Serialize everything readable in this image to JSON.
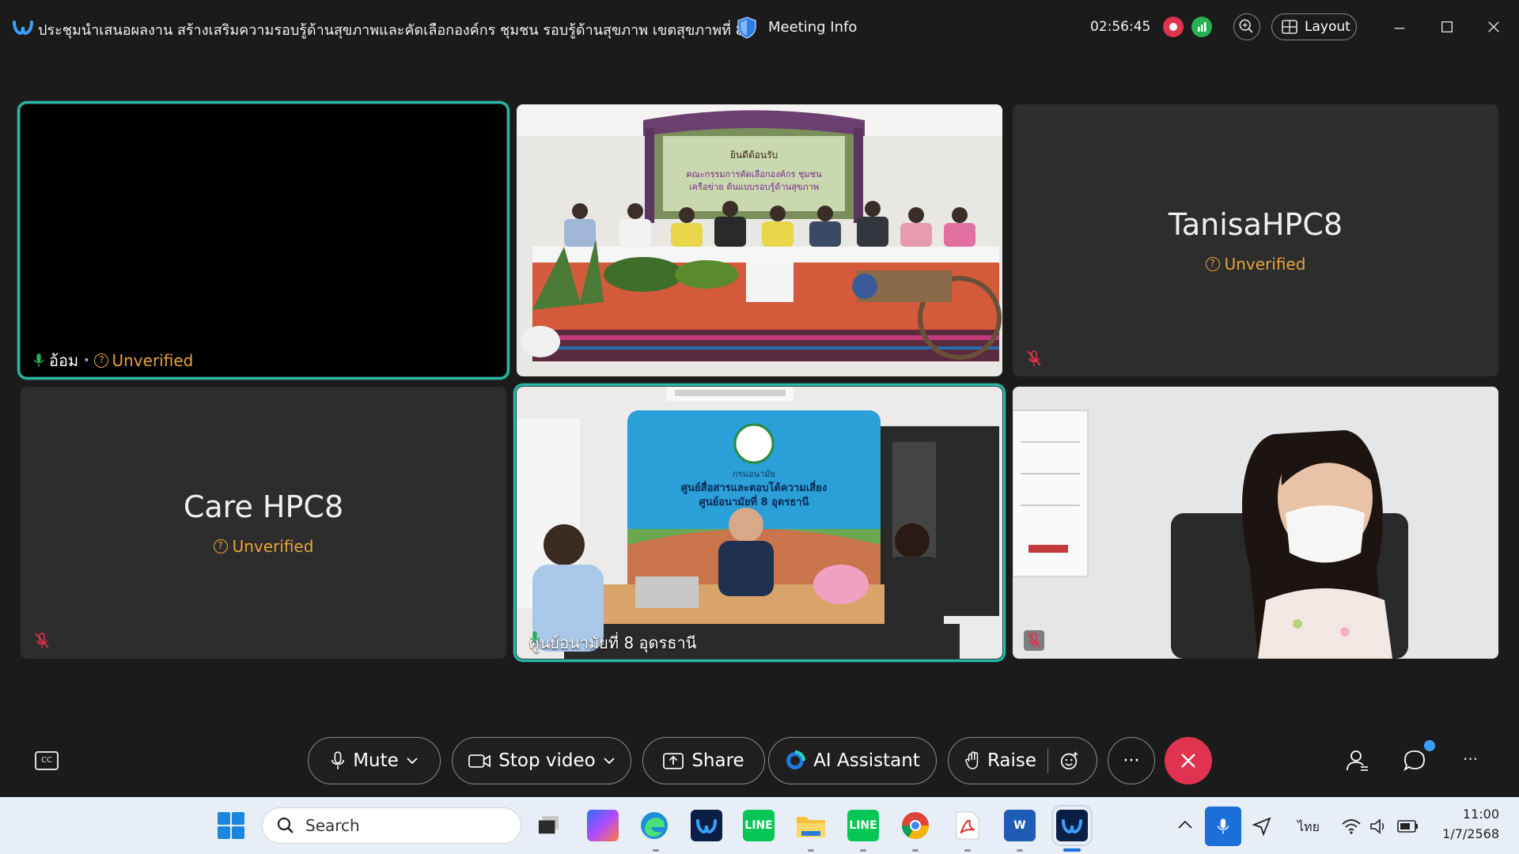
{
  "window": {
    "meeting_title": "ประชุมนำเสนอผลงาน สร้างเสริมความรอบรู้ด้านสุขภาพและคัดเลือกองค์กร ชุมชน รอบรู้ด้านสุขภาพ เขตสุขภาพที่ 8",
    "meeting_info_label": "Meeting Info",
    "timer": "02:56:45",
    "layout_label": "Layout"
  },
  "tiles": [
    {
      "name": "อ้อม",
      "status": "Unverified",
      "mic": "on",
      "active": true
    },
    {
      "name": "",
      "status": "",
      "mic": "none",
      "active": false
    },
    {
      "name": "TanisaHPC8",
      "status": "Unverified",
      "mic": "muted",
      "active": false
    },
    {
      "name": "Care HPC8",
      "status": "Unverified",
      "mic": "muted",
      "active": false
    },
    {
      "name": "ศูนย์อนามัยที่ 8 อุดรธานี",
      "status": "",
      "mic": "on",
      "active": true
    },
    {
      "name": "",
      "status": "",
      "mic": "muted",
      "active": false
    }
  ],
  "scene_text": {
    "banner_welcome": "ยินดีต้อนรับ",
    "banner_line1": "คณะกรรมการคัดเลือกองค์กร ชุมชน",
    "banner_line2": "เครือข่าย ต้นแบบรอบรู้ด้านสุขภาพ",
    "backdrop_dept": "กรมอนามัย",
    "backdrop_line1": "ศูนย์สื่อสารและตอบโต้ความเสี่ยง",
    "backdrop_line2": "ศูนย์อนามัยที่ 8 อุดรธานี"
  },
  "controls": {
    "mute": "Mute",
    "stop_video": "Stop video",
    "share": "Share",
    "ai_assistant": "AI Assistant",
    "raise": "Raise",
    "more": "···"
  },
  "taskbar": {
    "search_placeholder": "Search",
    "language": "ไทย",
    "time": "11:00",
    "date": "1/7/2568"
  },
  "colors": {
    "accent_teal": "#27b8a6",
    "end_red": "#e0334f",
    "unverified_orange": "#e8a43a"
  }
}
